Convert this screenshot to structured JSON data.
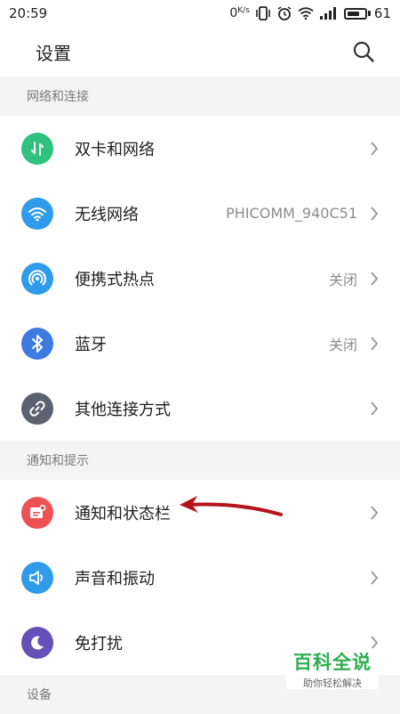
{
  "status_bar": {
    "time": "20:59",
    "net_speed": "0",
    "net_speed_unit": "K/s",
    "battery": "61"
  },
  "header": {
    "title": "设置",
    "search_icon": "search-icon"
  },
  "sections": [
    {
      "title": "网络和连接",
      "items": [
        {
          "label": "双卡和网络",
          "value": "",
          "icon": "dual-sim-icon",
          "color": "#2ec27e"
        },
        {
          "label": "无线网络",
          "value": "PHICOMM_940C51",
          "icon": "wifi-icon",
          "color": "#2f9bea"
        },
        {
          "label": "便携式热点",
          "value": "关闭",
          "icon": "hotspot-icon",
          "color": "#2f9bea"
        },
        {
          "label": "蓝牙",
          "value": "关闭",
          "icon": "bluetooth-icon",
          "color": "#3d7be0"
        },
        {
          "label": "其他连接方式",
          "value": "",
          "icon": "link-icon",
          "color": "#5c6270"
        }
      ]
    },
    {
      "title": "通知和提示",
      "items": [
        {
          "label": "通知和状态栏",
          "value": "",
          "icon": "notification-icon",
          "color": "#ee5154"
        },
        {
          "label": "声音和振动",
          "value": "",
          "icon": "sound-icon",
          "color": "#2f9bea"
        },
        {
          "label": "免打扰",
          "value": "",
          "icon": "moon-icon",
          "color": "#6550b8"
        }
      ]
    },
    {
      "title": "设备",
      "items": []
    }
  ],
  "watermark": {
    "title": "百科全说",
    "subtitle": "助你轻松解决"
  }
}
